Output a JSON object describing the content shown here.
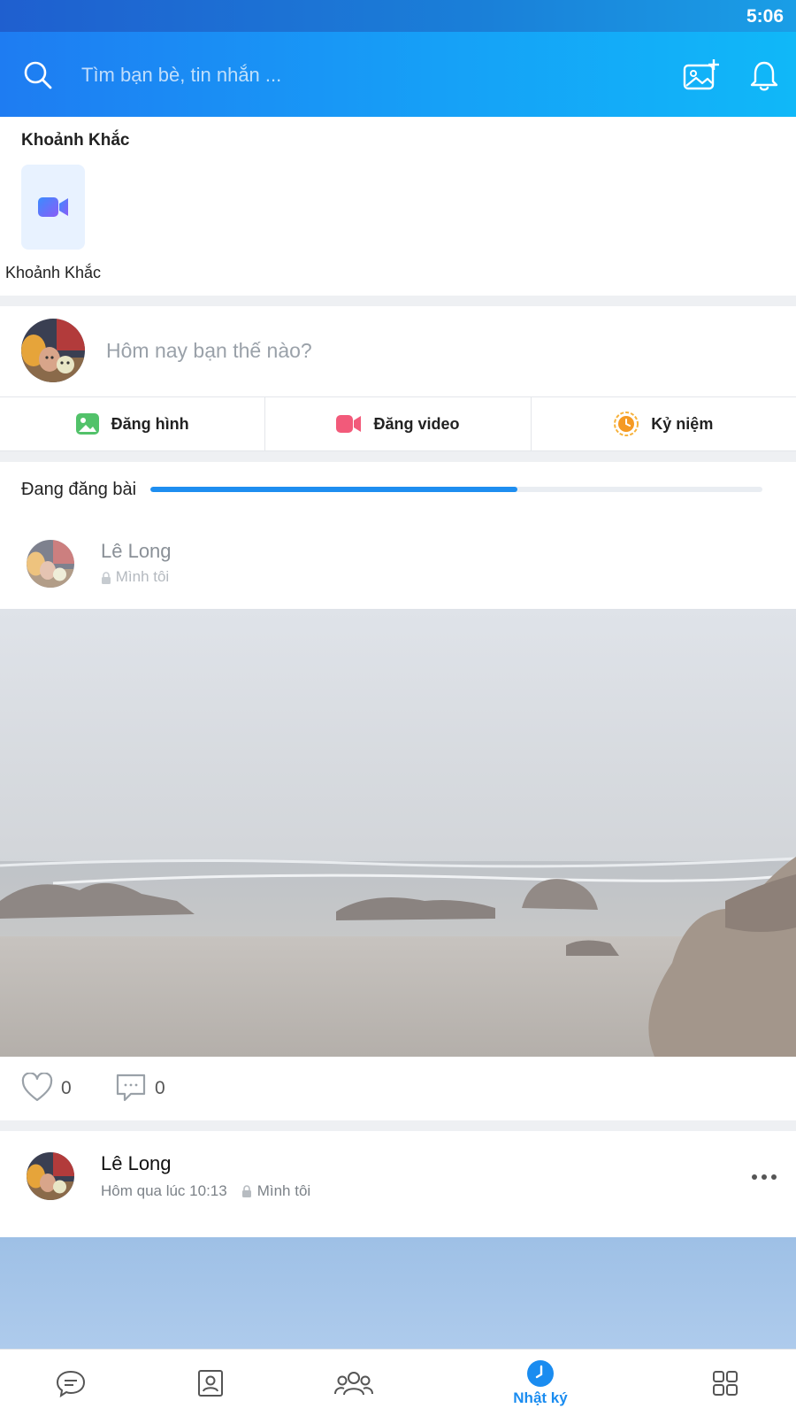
{
  "status_bar": {
    "time": "5:06"
  },
  "header": {
    "search_placeholder": "Tìm bạn bè, tin nhắn ...",
    "icons": [
      "search-icon",
      "add-photo-icon",
      "bell-icon"
    ]
  },
  "moments": {
    "title": "Khoảnh Khắc",
    "create_label": "Khoảnh Khắc"
  },
  "composer": {
    "prompt": "Hôm nay bạn thế nào?",
    "actions": [
      {
        "label": "Đăng hình",
        "icon": "photo-icon"
      },
      {
        "label": "Đăng video",
        "icon": "video-icon"
      },
      {
        "label": "Kỷ niệm",
        "icon": "memory-clock-icon"
      }
    ]
  },
  "uploading_post": {
    "status_text": "Đang đăng bài",
    "progress_percent": 60,
    "author": "Lê Long",
    "privacy": "Mình tôi",
    "likes": "0",
    "comments": "0"
  },
  "post": {
    "author": "Lê Long",
    "time": "Hôm qua lúc 10:13",
    "privacy": "Mình tôi"
  },
  "bottom_nav": {
    "items": [
      {
        "icon": "messages-icon"
      },
      {
        "icon": "contacts-icon"
      },
      {
        "icon": "groups-icon"
      },
      {
        "icon": "timeline-icon",
        "label": "Nhật ký",
        "active": true
      },
      {
        "icon": "more-apps-icon"
      }
    ]
  },
  "colors": {
    "accent": "#1a8cf0",
    "header_start": "#1e7cf2",
    "header_end": "#10b8f8"
  }
}
